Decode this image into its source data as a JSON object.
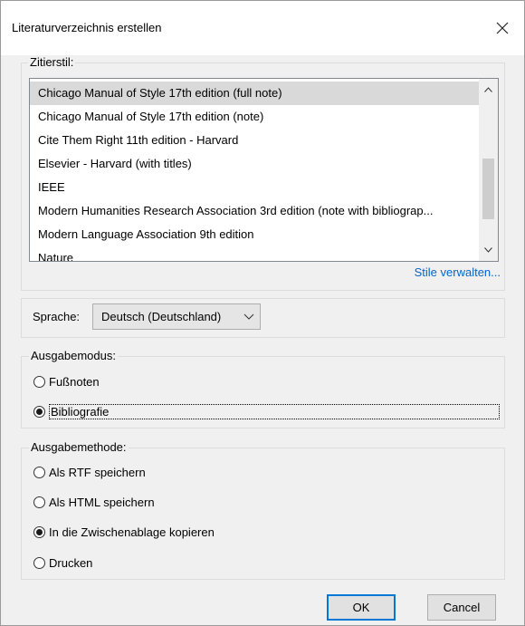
{
  "window": {
    "title": "Literaturverzeichnis erstellen"
  },
  "citation_style": {
    "group_label": "Zitierstil:",
    "items": [
      {
        "label": "Chicago Manual of Style 17th edition (full note)",
        "selected": true
      },
      {
        "label": "Chicago Manual of Style 17th edition (note)"
      },
      {
        "label": "Cite Them Right 11th edition - Harvard"
      },
      {
        "label": "Elsevier - Harvard (with titles)"
      },
      {
        "label": "IEEE"
      },
      {
        "label": "Modern Humanities Research Association 3rd edition (note with bibliograp..."
      },
      {
        "label": "Modern Language Association 9th edition"
      },
      {
        "label": "Nature"
      }
    ],
    "manage_link": "Stile verwalten..."
  },
  "language": {
    "label": "Sprache:",
    "value": "Deutsch (Deutschland)"
  },
  "output_mode": {
    "group_label": "Ausgabemodus:",
    "options": [
      {
        "label": "Fußnoten",
        "checked": false
      },
      {
        "label": "Bibliografie",
        "checked": true
      }
    ]
  },
  "output_method": {
    "group_label": "Ausgabemethode:",
    "options": [
      {
        "label": "Als RTF speichern",
        "checked": false
      },
      {
        "label": "Als HTML speichern",
        "checked": false
      },
      {
        "label": "In die Zwischenablage kopieren",
        "checked": true
      },
      {
        "label": "Drucken",
        "checked": false
      }
    ]
  },
  "buttons": {
    "ok": "OK",
    "cancel": "Cancel"
  },
  "icons": {
    "close": "close-icon",
    "scroll_up": "chevron-up-icon",
    "scroll_down": "chevron-down-icon",
    "dropdown": "chevron-down-icon"
  }
}
